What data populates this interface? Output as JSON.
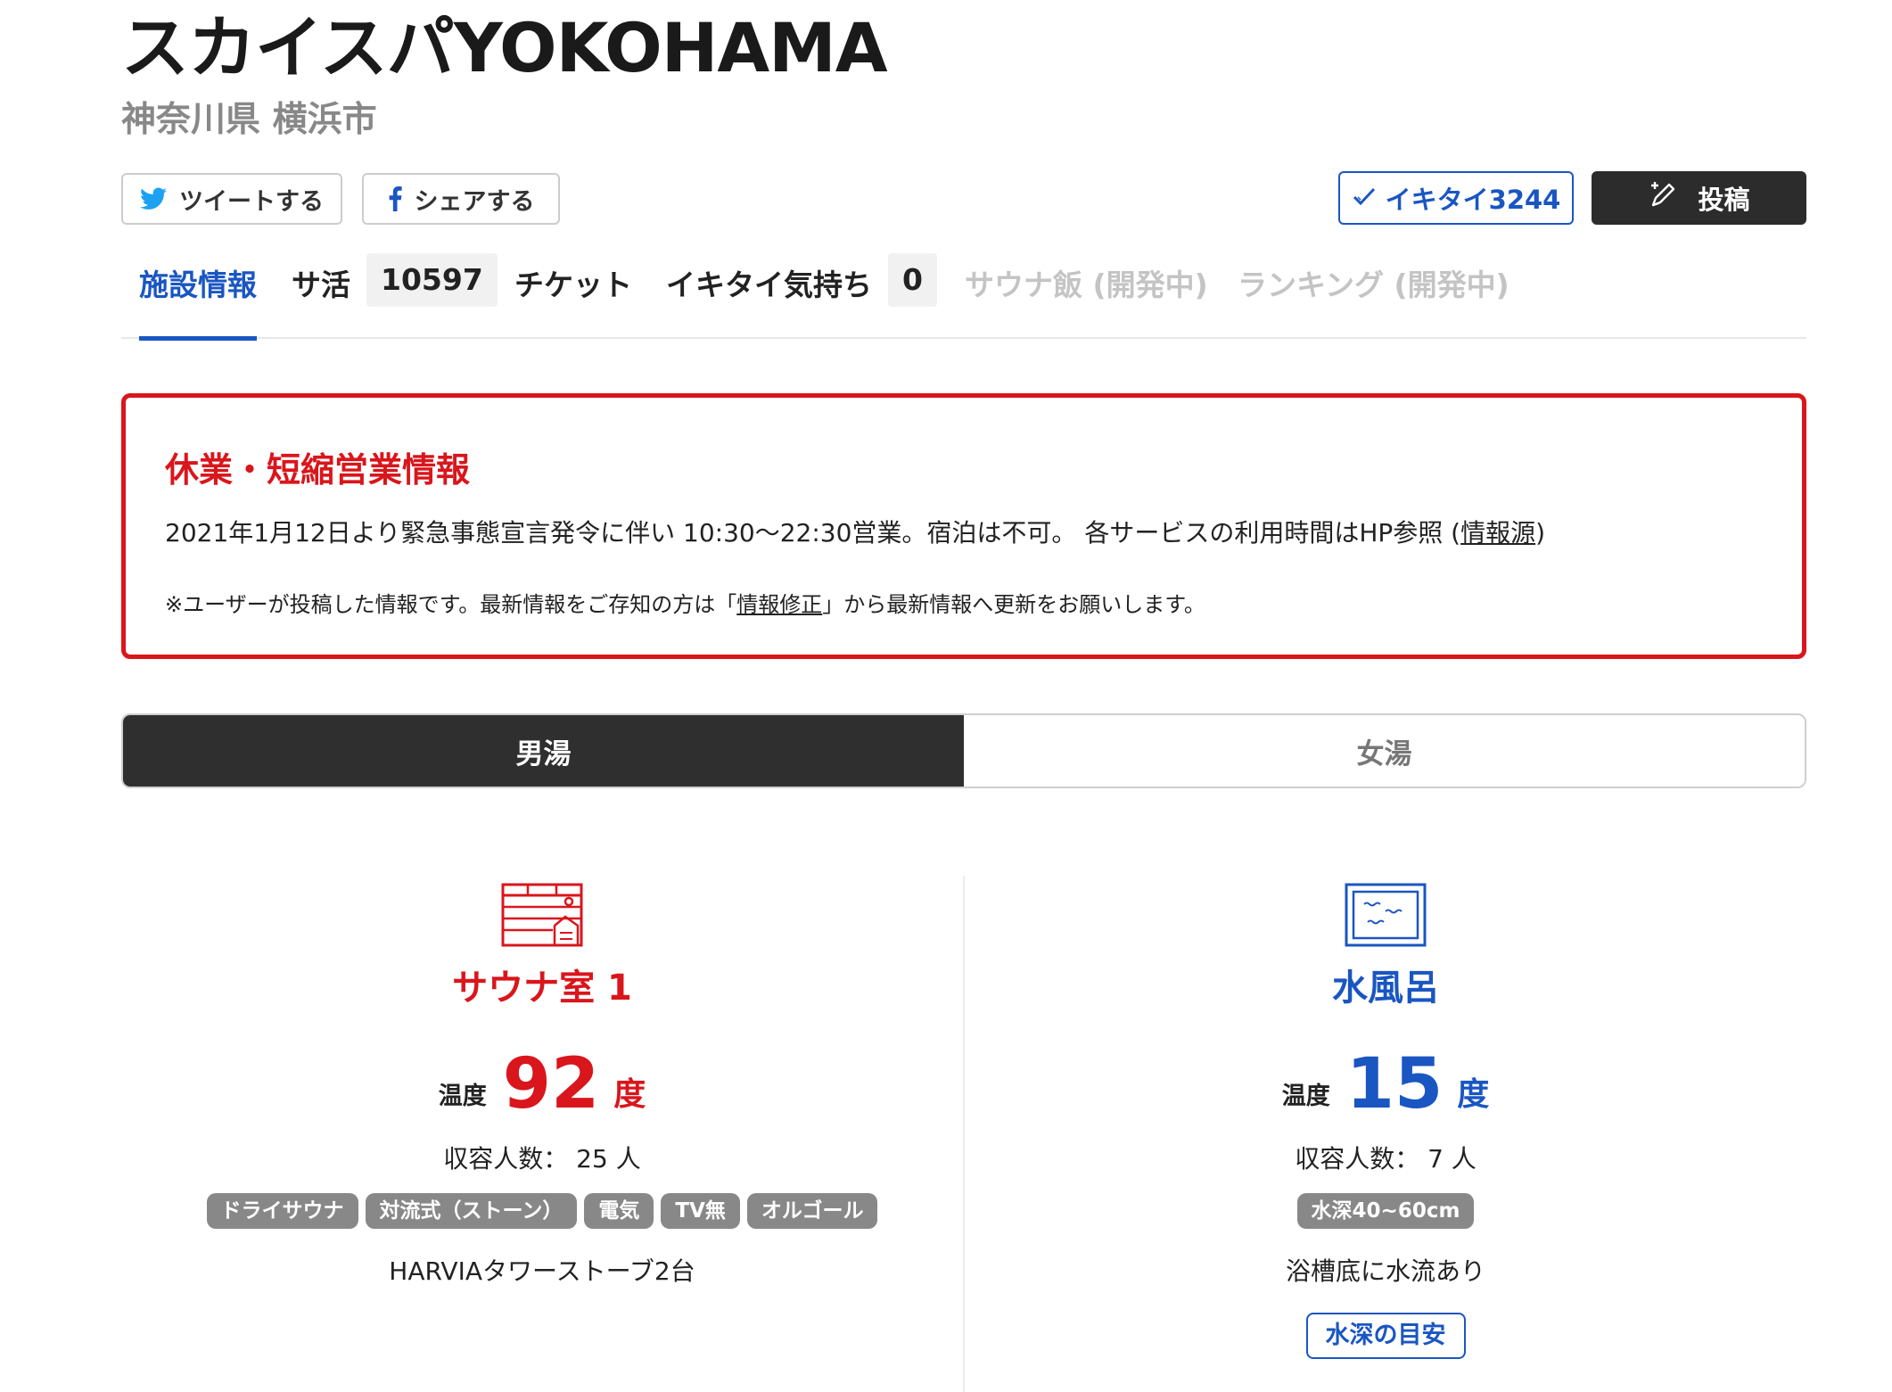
{
  "facility": {
    "name": "スカイスパYOKOHAMA",
    "location": "神奈川県 横浜市"
  },
  "share": {
    "tweet_label": "ツイートする",
    "facebook_label": "シェアする"
  },
  "actions": {
    "ikitai_label": "イキタイ3244",
    "post_label": "投稿"
  },
  "tabs": [
    {
      "label": "施設情報"
    },
    {
      "label": "サ活",
      "count": "10597"
    },
    {
      "label": "チケット"
    },
    {
      "label": "イキタイ気持ち",
      "count": "0"
    },
    {
      "label": "サウナ飯 (開発中)"
    },
    {
      "label": "ランキング (開発中)"
    }
  ],
  "notice": {
    "title": "休業・短縮営業情報",
    "body": "2021年1月12日より緊急事態宣言発令に伴い 10:30〜22:30営業。宿泊は不可。 各サービスの利用時間はHP参照 (",
    "source_link": "情報源",
    "body_end": ")",
    "note_start": "※ユーザーが投稿した情報です。最新情報をご存知の方は「",
    "note_link": "情報修正",
    "note_end": "」から最新情報へ更新をお願いします。"
  },
  "gender_tabs": {
    "men": "男湯",
    "women": "女湯"
  },
  "sauna": {
    "name": "サウナ室 1",
    "temp_label": "温度",
    "temp_value": "92",
    "temp_unit": "度",
    "capacity": "収容人数： 25 人",
    "tags": [
      "ドライサウナ",
      "対流式（ストーン）",
      "電気",
      "TV無",
      "オルゴール"
    ],
    "description": "HARVIAタワーストーブ2台"
  },
  "water_bath": {
    "name": "水風呂",
    "temp_label": "温度",
    "temp_value": "15",
    "temp_unit": "度",
    "capacity": "収容人数： 7 人",
    "tags": [
      "水深40~60cm"
    ],
    "description": "浴槽底に水流あり",
    "depth_button": "水深の目安"
  },
  "colors": {
    "accent_blue": "#1a56c2",
    "alert_red": "#d9161c",
    "dark": "#2c2c2c",
    "tag_gray": "#888888"
  },
  "icons": {
    "twitter": "twitter-icon",
    "facebook": "facebook-icon",
    "check": "check-icon",
    "pen": "pen-icon",
    "sauna": "sauna-room-icon",
    "water": "water-bath-icon"
  }
}
